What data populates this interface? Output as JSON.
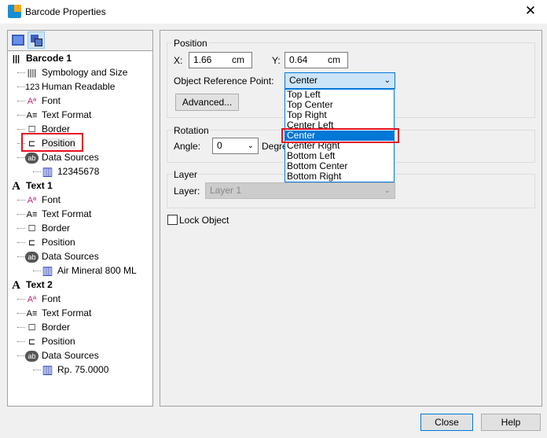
{
  "window": {
    "title": "Barcode Properties",
    "close": "✕"
  },
  "tree": [
    {
      "label": "Barcode 1",
      "level": 0,
      "icon": "barcode-icon"
    },
    {
      "label": "Symbology and Size",
      "level": 1,
      "icon": "barcode-bars-icon"
    },
    {
      "label": "Human Readable",
      "level": 1,
      "icon": "123-icon"
    },
    {
      "label": "Font",
      "level": 1,
      "icon": "font-icon"
    },
    {
      "label": "Text Format",
      "level": 1,
      "icon": "text-format-icon"
    },
    {
      "label": "Border",
      "level": 1,
      "icon": "border-icon"
    },
    {
      "label": "Position",
      "level": 1,
      "icon": "ruler-icon",
      "highlighted": true
    },
    {
      "label": "Data Sources",
      "level": 1,
      "icon": "data-source-icon"
    },
    {
      "label": "12345678",
      "level": 2,
      "icon": "barcode-data-icon"
    },
    {
      "label": "Text 1",
      "level": 0,
      "icon": "text-icon"
    },
    {
      "label": "Font",
      "level": 1,
      "icon": "font-icon"
    },
    {
      "label": "Text Format",
      "level": 1,
      "icon": "text-format-icon"
    },
    {
      "label": "Border",
      "level": 1,
      "icon": "border-icon"
    },
    {
      "label": "Position",
      "level": 1,
      "icon": "ruler-icon"
    },
    {
      "label": "Data Sources",
      "level": 1,
      "icon": "data-source-icon"
    },
    {
      "label": "Air Mineral 800 ML",
      "level": 2,
      "icon": "barcode-data-icon"
    },
    {
      "label": "Text 2",
      "level": 0,
      "icon": "text-icon"
    },
    {
      "label": "Font",
      "level": 1,
      "icon": "font-icon"
    },
    {
      "label": "Text Format",
      "level": 1,
      "icon": "text-format-icon"
    },
    {
      "label": "Border",
      "level": 1,
      "icon": "border-icon"
    },
    {
      "label": "Position",
      "level": 1,
      "icon": "ruler-icon"
    },
    {
      "label": "Data Sources",
      "level": 1,
      "icon": "data-source-icon"
    },
    {
      "label": "Rp. 75.0000",
      "level": 2,
      "icon": "barcode-data-icon"
    }
  ],
  "position": {
    "group": "Position",
    "x_label": "X:",
    "x_value": "1.66",
    "x_unit": "cm",
    "y_label": "Y:",
    "y_value": "0.64",
    "y_unit": "cm",
    "ref_label": "Object Reference Point:",
    "ref_value": "Center",
    "advanced": "Advanced...",
    "options": [
      "Top Left",
      "Top Center",
      "Top Right",
      "Center Left",
      "Center",
      "Center Right",
      "Bottom Left",
      "Bottom Center",
      "Bottom Right"
    ],
    "selected_index": 4
  },
  "rotation": {
    "group": "Rotation",
    "angle_label": "Angle:",
    "angle_value": "0",
    "unit": "Degre"
  },
  "layer": {
    "group": "Layer",
    "label": "Layer:",
    "value": "Layer 1"
  },
  "lock": {
    "label": "Lock Object",
    "checked": false
  },
  "buttons": {
    "close": "Close",
    "help": "Help"
  },
  "colors": {
    "accent": "#0078d7",
    "highlight": "#e81123"
  }
}
